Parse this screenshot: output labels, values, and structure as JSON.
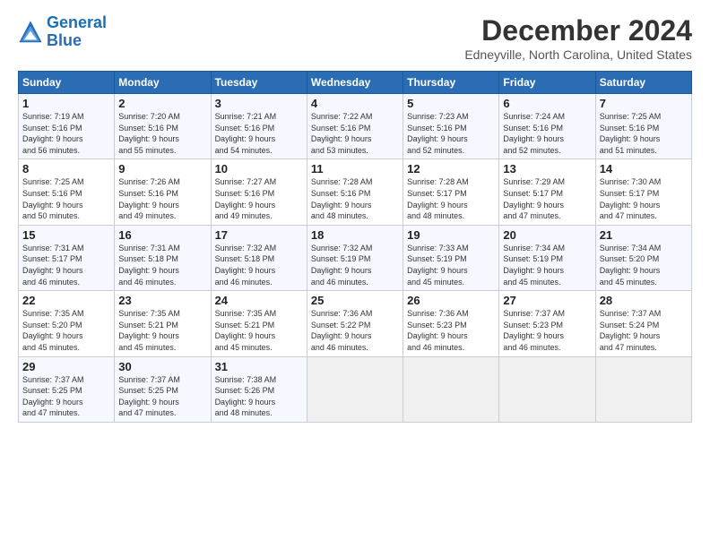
{
  "logo": {
    "line1": "General",
    "line2": "Blue"
  },
  "header": {
    "month": "December 2024",
    "location": "Edneyville, North Carolina, United States"
  },
  "weekdays": [
    "Sunday",
    "Monday",
    "Tuesday",
    "Wednesday",
    "Thursday",
    "Friday",
    "Saturday"
  ],
  "weeks": [
    [
      {
        "day": "1",
        "info": "Sunrise: 7:19 AM\nSunset: 5:16 PM\nDaylight: 9 hours\nand 56 minutes."
      },
      {
        "day": "2",
        "info": "Sunrise: 7:20 AM\nSunset: 5:16 PM\nDaylight: 9 hours\nand 55 minutes."
      },
      {
        "day": "3",
        "info": "Sunrise: 7:21 AM\nSunset: 5:16 PM\nDaylight: 9 hours\nand 54 minutes."
      },
      {
        "day": "4",
        "info": "Sunrise: 7:22 AM\nSunset: 5:16 PM\nDaylight: 9 hours\nand 53 minutes."
      },
      {
        "day": "5",
        "info": "Sunrise: 7:23 AM\nSunset: 5:16 PM\nDaylight: 9 hours\nand 52 minutes."
      },
      {
        "day": "6",
        "info": "Sunrise: 7:24 AM\nSunset: 5:16 PM\nDaylight: 9 hours\nand 52 minutes."
      },
      {
        "day": "7",
        "info": "Sunrise: 7:25 AM\nSunset: 5:16 PM\nDaylight: 9 hours\nand 51 minutes."
      }
    ],
    [
      {
        "day": "8",
        "info": "Sunrise: 7:25 AM\nSunset: 5:16 PM\nDaylight: 9 hours\nand 50 minutes."
      },
      {
        "day": "9",
        "info": "Sunrise: 7:26 AM\nSunset: 5:16 PM\nDaylight: 9 hours\nand 49 minutes."
      },
      {
        "day": "10",
        "info": "Sunrise: 7:27 AM\nSunset: 5:16 PM\nDaylight: 9 hours\nand 49 minutes."
      },
      {
        "day": "11",
        "info": "Sunrise: 7:28 AM\nSunset: 5:16 PM\nDaylight: 9 hours\nand 48 minutes."
      },
      {
        "day": "12",
        "info": "Sunrise: 7:28 AM\nSunset: 5:17 PM\nDaylight: 9 hours\nand 48 minutes."
      },
      {
        "day": "13",
        "info": "Sunrise: 7:29 AM\nSunset: 5:17 PM\nDaylight: 9 hours\nand 47 minutes."
      },
      {
        "day": "14",
        "info": "Sunrise: 7:30 AM\nSunset: 5:17 PM\nDaylight: 9 hours\nand 47 minutes."
      }
    ],
    [
      {
        "day": "15",
        "info": "Sunrise: 7:31 AM\nSunset: 5:17 PM\nDaylight: 9 hours\nand 46 minutes."
      },
      {
        "day": "16",
        "info": "Sunrise: 7:31 AM\nSunset: 5:18 PM\nDaylight: 9 hours\nand 46 minutes."
      },
      {
        "day": "17",
        "info": "Sunrise: 7:32 AM\nSunset: 5:18 PM\nDaylight: 9 hours\nand 46 minutes."
      },
      {
        "day": "18",
        "info": "Sunrise: 7:32 AM\nSunset: 5:19 PM\nDaylight: 9 hours\nand 46 minutes."
      },
      {
        "day": "19",
        "info": "Sunrise: 7:33 AM\nSunset: 5:19 PM\nDaylight: 9 hours\nand 45 minutes."
      },
      {
        "day": "20",
        "info": "Sunrise: 7:34 AM\nSunset: 5:19 PM\nDaylight: 9 hours\nand 45 minutes."
      },
      {
        "day": "21",
        "info": "Sunrise: 7:34 AM\nSunset: 5:20 PM\nDaylight: 9 hours\nand 45 minutes."
      }
    ],
    [
      {
        "day": "22",
        "info": "Sunrise: 7:35 AM\nSunset: 5:20 PM\nDaylight: 9 hours\nand 45 minutes."
      },
      {
        "day": "23",
        "info": "Sunrise: 7:35 AM\nSunset: 5:21 PM\nDaylight: 9 hours\nand 45 minutes."
      },
      {
        "day": "24",
        "info": "Sunrise: 7:35 AM\nSunset: 5:21 PM\nDaylight: 9 hours\nand 45 minutes."
      },
      {
        "day": "25",
        "info": "Sunrise: 7:36 AM\nSunset: 5:22 PM\nDaylight: 9 hours\nand 46 minutes."
      },
      {
        "day": "26",
        "info": "Sunrise: 7:36 AM\nSunset: 5:23 PM\nDaylight: 9 hours\nand 46 minutes."
      },
      {
        "day": "27",
        "info": "Sunrise: 7:37 AM\nSunset: 5:23 PM\nDaylight: 9 hours\nand 46 minutes."
      },
      {
        "day": "28",
        "info": "Sunrise: 7:37 AM\nSunset: 5:24 PM\nDaylight: 9 hours\nand 47 minutes."
      }
    ],
    [
      {
        "day": "29",
        "info": "Sunrise: 7:37 AM\nSunset: 5:25 PM\nDaylight: 9 hours\nand 47 minutes."
      },
      {
        "day": "30",
        "info": "Sunrise: 7:37 AM\nSunset: 5:25 PM\nDaylight: 9 hours\nand 47 minutes."
      },
      {
        "day": "31",
        "info": "Sunrise: 7:38 AM\nSunset: 5:26 PM\nDaylight: 9 hours\nand 48 minutes."
      },
      null,
      null,
      null,
      null
    ]
  ]
}
